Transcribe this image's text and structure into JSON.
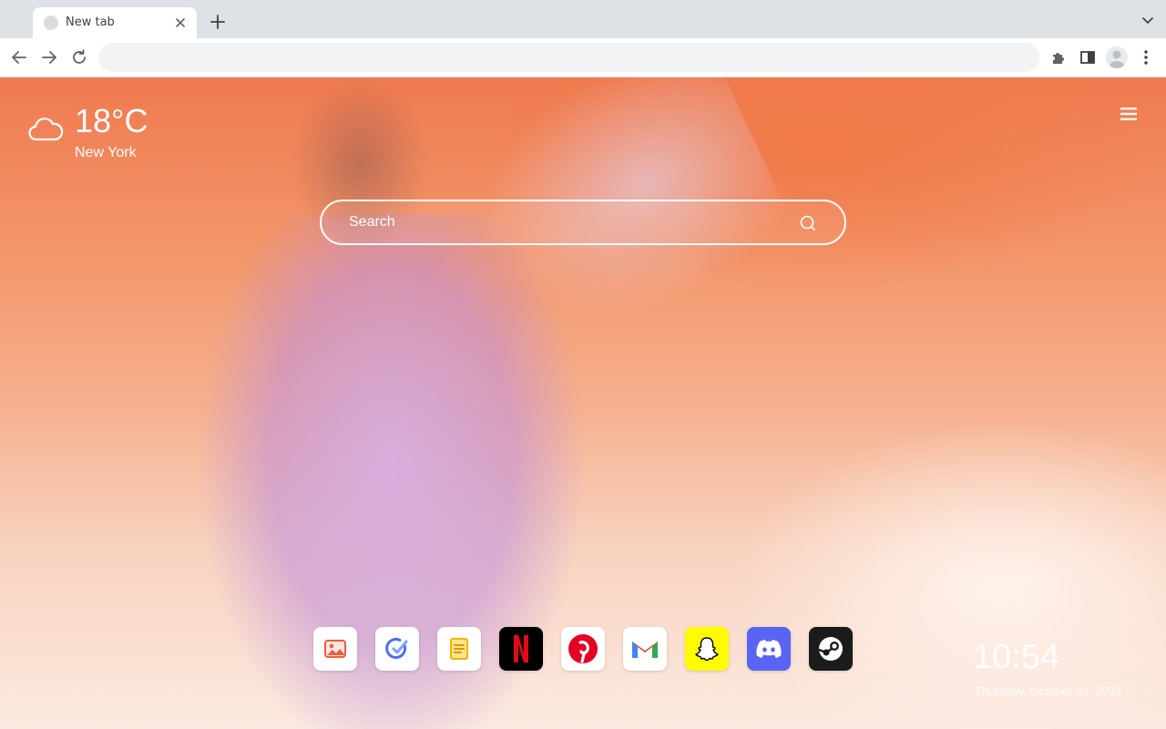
{
  "browser": {
    "tab": {
      "title": "New tab"
    },
    "omnibox": {
      "value": ""
    },
    "icons": [
      "tab-favicon",
      "close-icon",
      "plus-icon",
      "chevron-down-icon",
      "back-icon",
      "forward-icon",
      "reload-icon",
      "extensions-icon",
      "side-panel-icon",
      "profile-avatar",
      "more-vert-icon"
    ]
  },
  "weather": {
    "temp": "18°C",
    "city": "New York",
    "icon": "cloud-icon"
  },
  "search": {
    "placeholder": "Search"
  },
  "dock": {
    "apps": [
      {
        "name": "photos",
        "color": "#f25c3a"
      },
      {
        "name": "tasks",
        "color": "#4c6ef5"
      },
      {
        "name": "notes",
        "color": "#f5b300"
      },
      {
        "name": "netflix",
        "color": "#e50914"
      },
      {
        "name": "pinterest",
        "color": "#e60023"
      },
      {
        "name": "gmail",
        "color": "#ea4335"
      },
      {
        "name": "snapchat",
        "color": "#fffc00"
      },
      {
        "name": "discord",
        "color": "#5865f2"
      },
      {
        "name": "steam",
        "color": "#1b1b1b"
      }
    ]
  },
  "clock": {
    "time": "10:54",
    "date": "Thursday, October 30, 2023"
  }
}
